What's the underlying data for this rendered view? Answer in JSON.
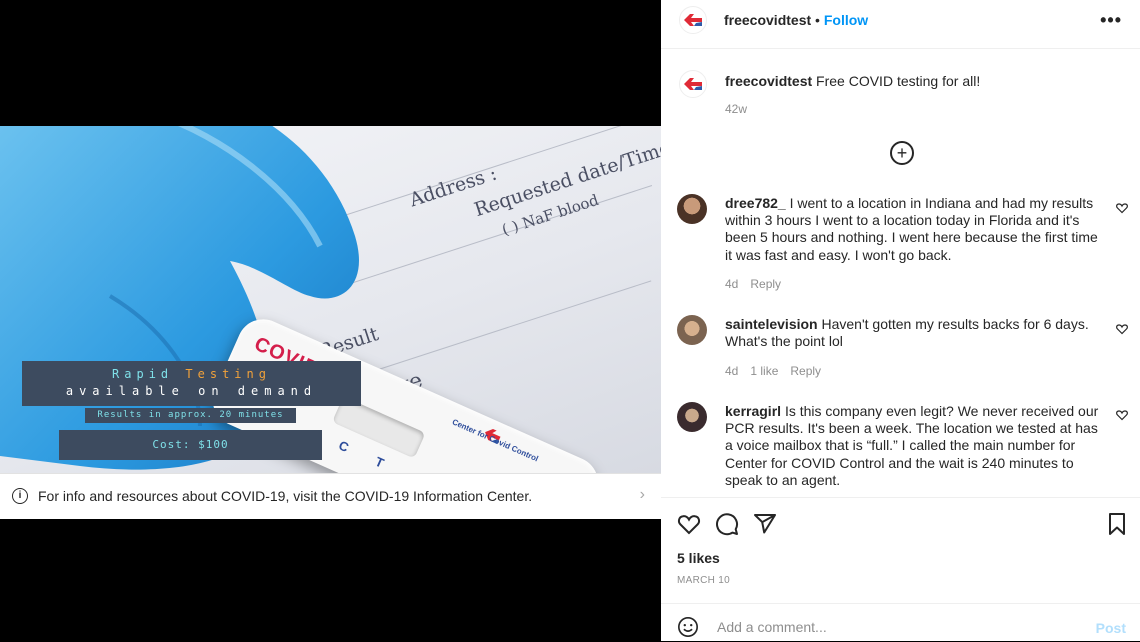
{
  "post": {
    "username": "freecovidtest",
    "follow_label": "Follow",
    "dot": "•",
    "more_icon": "more-horizontal-icon",
    "caption_user": "freecovidtest",
    "caption_text": "Free COVID testing for all!",
    "caption_time": "42w"
  },
  "image": {
    "form_address": "Address :",
    "form_requested": "Requested date/Time",
    "form_naf": "( ) NaF blood",
    "form_result": "Result",
    "form_native": "native",
    "cassette_label": "COVID-19",
    "cassette_brand": "Center for Covid Control",
    "cassette_c": "C",
    "cassette_t": "T",
    "banner_line1_a": "Rapid ",
    "banner_line1_b": "Testing",
    "banner_line2": "available on demand",
    "banner_results": "Results in approx. 20 minutes",
    "banner_cost": "Cost: $100"
  },
  "infobar": {
    "text": "For info and resources about COVID-19, visit the COVID-19 Information Center.",
    "chevron": "›"
  },
  "comments": [
    {
      "user": "dree782_",
      "text": "I went to a location in Indiana and had my results within 3 hours I went to a location today in Florida and it's been 5 hours and nothing. I went here because the first time it was fast and easy. I won't go back.",
      "time": "4d",
      "likes": "",
      "reply": "Reply"
    },
    {
      "user": "saintelevision",
      "text": "Haven't gotten my results backs for 6 days. What's the point lol",
      "time": "4d",
      "likes": "1 like",
      "reply": "Reply"
    },
    {
      "user": "kerragirl",
      "text": "Is this company even legit? We never received our PCR results. It's been a week. The location we tested at has a voice mailbox that is “full.” I called the main number for Center for COVID Control and the wait is 240 minutes to speak to an agent.",
      "time": "",
      "likes": "",
      "reply": ""
    }
  ],
  "footer": {
    "likes": "5 likes",
    "date": "MARCH 10",
    "comment_placeholder": "Add a comment...",
    "post_label": "Post"
  },
  "colors": {
    "link_blue": "#0095f6",
    "logo_red": "#e02a36",
    "logo_blue": "#2f5aa8",
    "banner_bg": "#3d4b5f",
    "banner_cyan": "#7fe0e8",
    "banner_orange": "#f2a23a"
  }
}
